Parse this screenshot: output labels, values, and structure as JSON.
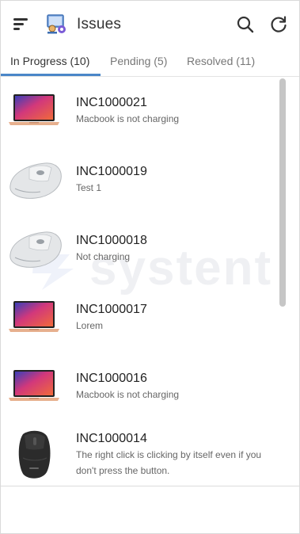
{
  "header": {
    "title": "Issues",
    "menu_icon": "hamburger-menu-icon",
    "logo_icon": "issues-app-logo-icon",
    "search_icon": "search-icon",
    "refresh_icon": "refresh-icon"
  },
  "tabs": [
    {
      "label": "In Progress (10)",
      "active": true
    },
    {
      "label": "Pending (5)",
      "active": false
    },
    {
      "label": "Resolved (11)",
      "active": false
    }
  ],
  "colors": {
    "accent": "#4a86c8",
    "text_primary": "#222222",
    "text_secondary": "#666666"
  },
  "watermark": {
    "text": "systent"
  },
  "issues": [
    {
      "id": "INC1000021",
      "description": "Macbook is not charging",
      "image": "laptop-icon"
    },
    {
      "id": "INC1000019",
      "description": "Test 1",
      "image": "mouse-icon"
    },
    {
      "id": "INC1000018",
      "description": "Not charging",
      "image": "mouse-icon"
    },
    {
      "id": "INC1000017",
      "description": "Lorem",
      "image": "laptop-icon"
    },
    {
      "id": "INC1000016",
      "description": "Macbook is not charging",
      "image": "laptop-icon"
    },
    {
      "id": "INC1000014",
      "description": "The right click is clicking by itself even if you don't press the button.",
      "image": "black-mouse-icon"
    }
  ]
}
